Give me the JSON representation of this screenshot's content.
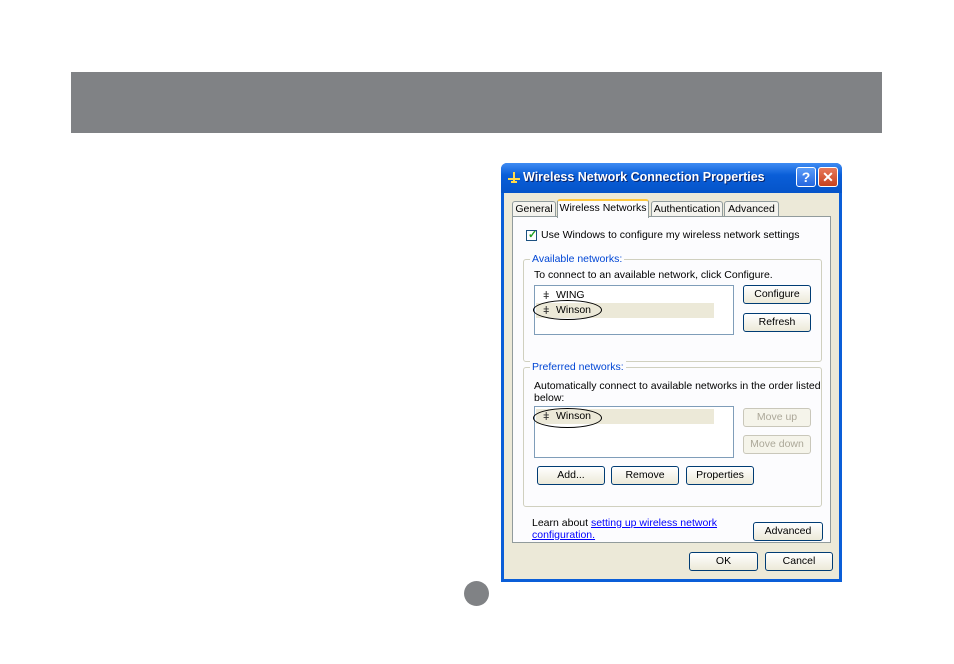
{
  "dialog": {
    "title": "Wireless Network Connection Properties",
    "help_label": "?",
    "close_label": "✕",
    "tabs": [
      {
        "label": "General"
      },
      {
        "label": "Wireless Networks"
      },
      {
        "label": "Authentication"
      },
      {
        "label": "Advanced"
      }
    ],
    "use_windows_checkbox": {
      "label": "Use Windows to configure my wireless network settings",
      "checked": true
    },
    "available": {
      "legend": "Available networks:",
      "description": "To connect to an available network, click Configure.",
      "networks": [
        "WING",
        "Winson"
      ],
      "configure_label": "Configure",
      "refresh_label": "Refresh"
    },
    "preferred": {
      "legend": "Preferred networks:",
      "description_line1": "Automatically connect to available networks in the order listed",
      "description_line2": "below:",
      "networks": [
        "Winson"
      ],
      "move_up_label": "Move up",
      "move_down_label": "Move down",
      "add_label": "Add...",
      "remove_label": "Remove",
      "properties_label": "Properties"
    },
    "learn": {
      "prefix": "Learn about ",
      "link_line1": "setting up wireless network",
      "link_line2": "configuration."
    },
    "advanced_label": "Advanced",
    "ok_label": "OK",
    "cancel_label": "Cancel"
  },
  "colors": {
    "banner": "#808285",
    "titlebar": "#0a5ed8",
    "group_label": "#0046d5",
    "link": "#0000ff"
  }
}
